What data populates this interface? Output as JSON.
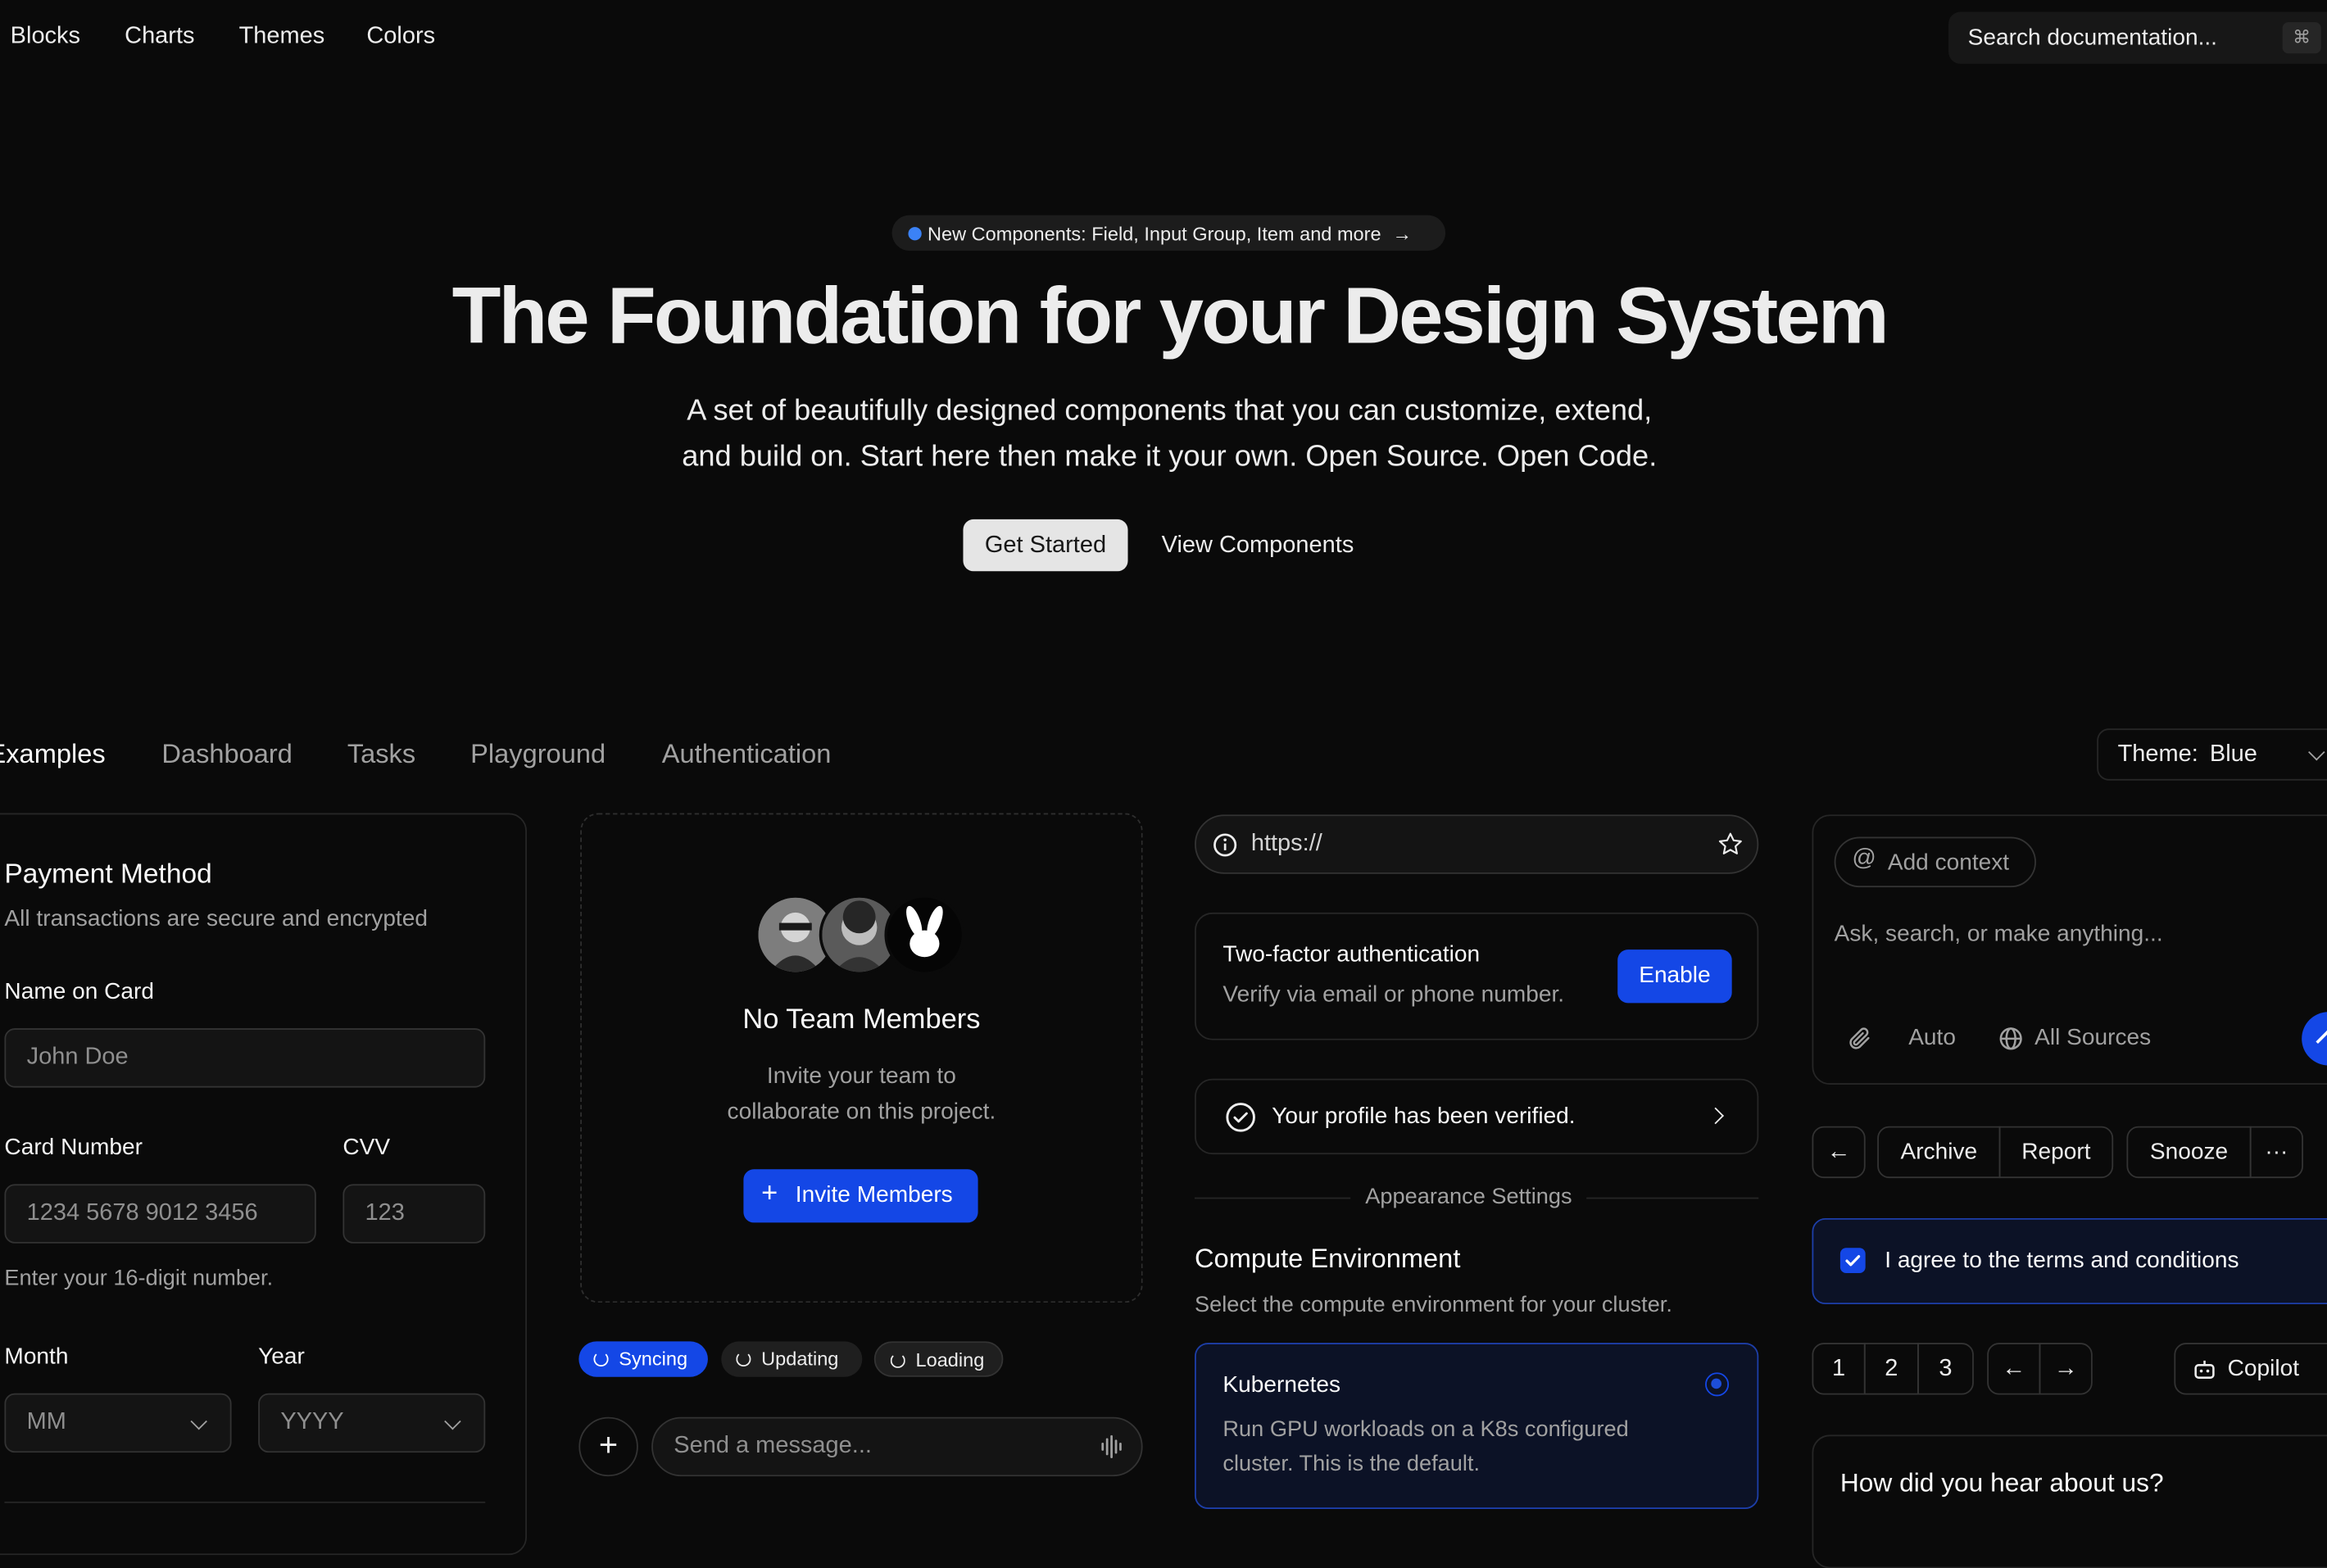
{
  "nav": {
    "items": [
      {
        "label": "Blocks"
      },
      {
        "label": "Charts"
      },
      {
        "label": "Themes"
      },
      {
        "label": "Colors"
      }
    ],
    "search_placeholder": "Search documentation...",
    "search_shortcut": "⌘"
  },
  "hero": {
    "announcement": "New Components: Field, Input Group, Item and more",
    "title": "The Foundation for your Design System",
    "description_line1": "A set of beautifully designed components that you can customize, extend,",
    "description_line2": "and build on. Start here then make it your own. Open Source. Open Code.",
    "primary_cta": "Get Started",
    "secondary_cta": "View Components"
  },
  "tabs": [
    {
      "label": "Examples",
      "active": true
    },
    {
      "label": "Dashboard"
    },
    {
      "label": "Tasks"
    },
    {
      "label": "Playground"
    },
    {
      "label": "Authentication"
    }
  ],
  "theme_selector": {
    "label": "Theme:",
    "value": "Blue"
  },
  "payment": {
    "title": "Payment Method",
    "subtitle": "All transactions are secure and encrypted",
    "name_label": "Name on Card",
    "name_placeholder": "John Doe",
    "card_label": "Card Number",
    "card_placeholder": "1234 5678 9012 3456",
    "cvv_label": "CVV",
    "cvv_placeholder": "123",
    "card_hint": "Enter your 16-digit number.",
    "month_label": "Month",
    "month_placeholder": "MM",
    "year_label": "Year",
    "year_placeholder": "YYYY"
  },
  "team": {
    "title": "No Team Members",
    "description_line1": "Invite your team to",
    "description_line2": "collaborate on this project.",
    "invite_button": "Invite Members",
    "badges": [
      {
        "label": "Syncing",
        "active": true
      },
      {
        "label": "Updating"
      },
      {
        "label": "Loading"
      }
    ],
    "message_placeholder": "Send a message..."
  },
  "settings": {
    "url_placeholder": "https://",
    "twofa_title": "Two-factor authentication",
    "twofa_description": "Verify via email or phone number.",
    "twofa_button": "Enable",
    "verified_text": "Your profile has been verified.",
    "separator_label": "Appearance Settings",
    "compute_title": "Compute Environment",
    "compute_description": "Select the compute environment for your cluster.",
    "option_title": "Kubernetes",
    "option_description_line1": "Run GPU workloads on a K8s configured",
    "option_description_line2": "cluster. This is the default."
  },
  "assistant": {
    "add_context": "Add context",
    "prompt_placeholder": "Ask, search, or make anything...",
    "mode": "Auto",
    "sources": "All Sources",
    "actions": {
      "archive": "Archive",
      "report": "Report",
      "snooze": "Snooze"
    },
    "terms": "I agree to the terms and conditions",
    "pages": [
      "1",
      "2",
      "3"
    ],
    "copilot": "Copilot",
    "survey_title": "How did you hear about us?"
  },
  "colors": {
    "accent": "#1447e6",
    "background": "#0a0a0a",
    "border": "#262626"
  }
}
